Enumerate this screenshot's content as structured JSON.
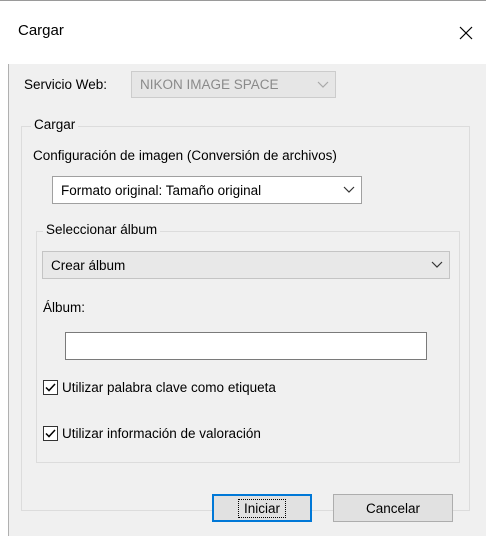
{
  "window": {
    "title": "Cargar",
    "close_glyph": "✕"
  },
  "service": {
    "label": "Servicio Web:",
    "selected": "NIKON IMAGE SPACE"
  },
  "upload_group": {
    "caption": "Cargar",
    "image_config_label": "Configuración de imagen (Conversión de archivos)",
    "format_selected": "Formato original: Tamaño original"
  },
  "album_group": {
    "caption": "Seleccionar álbum",
    "album_action_selected": "Crear álbum",
    "album_label": "Álbum:",
    "album_value": ""
  },
  "options": {
    "use_keyword": {
      "label": "Utilizar palabra clave como etiqueta",
      "checked": true
    },
    "use_rating": {
      "label": "Utilizar información de valoración",
      "checked": true
    }
  },
  "buttons": {
    "start": "Iniciar",
    "cancel": "Cancelar"
  },
  "colors": {
    "dialog_background": "#f0f0f0",
    "default_button_border": "#0078d7"
  }
}
